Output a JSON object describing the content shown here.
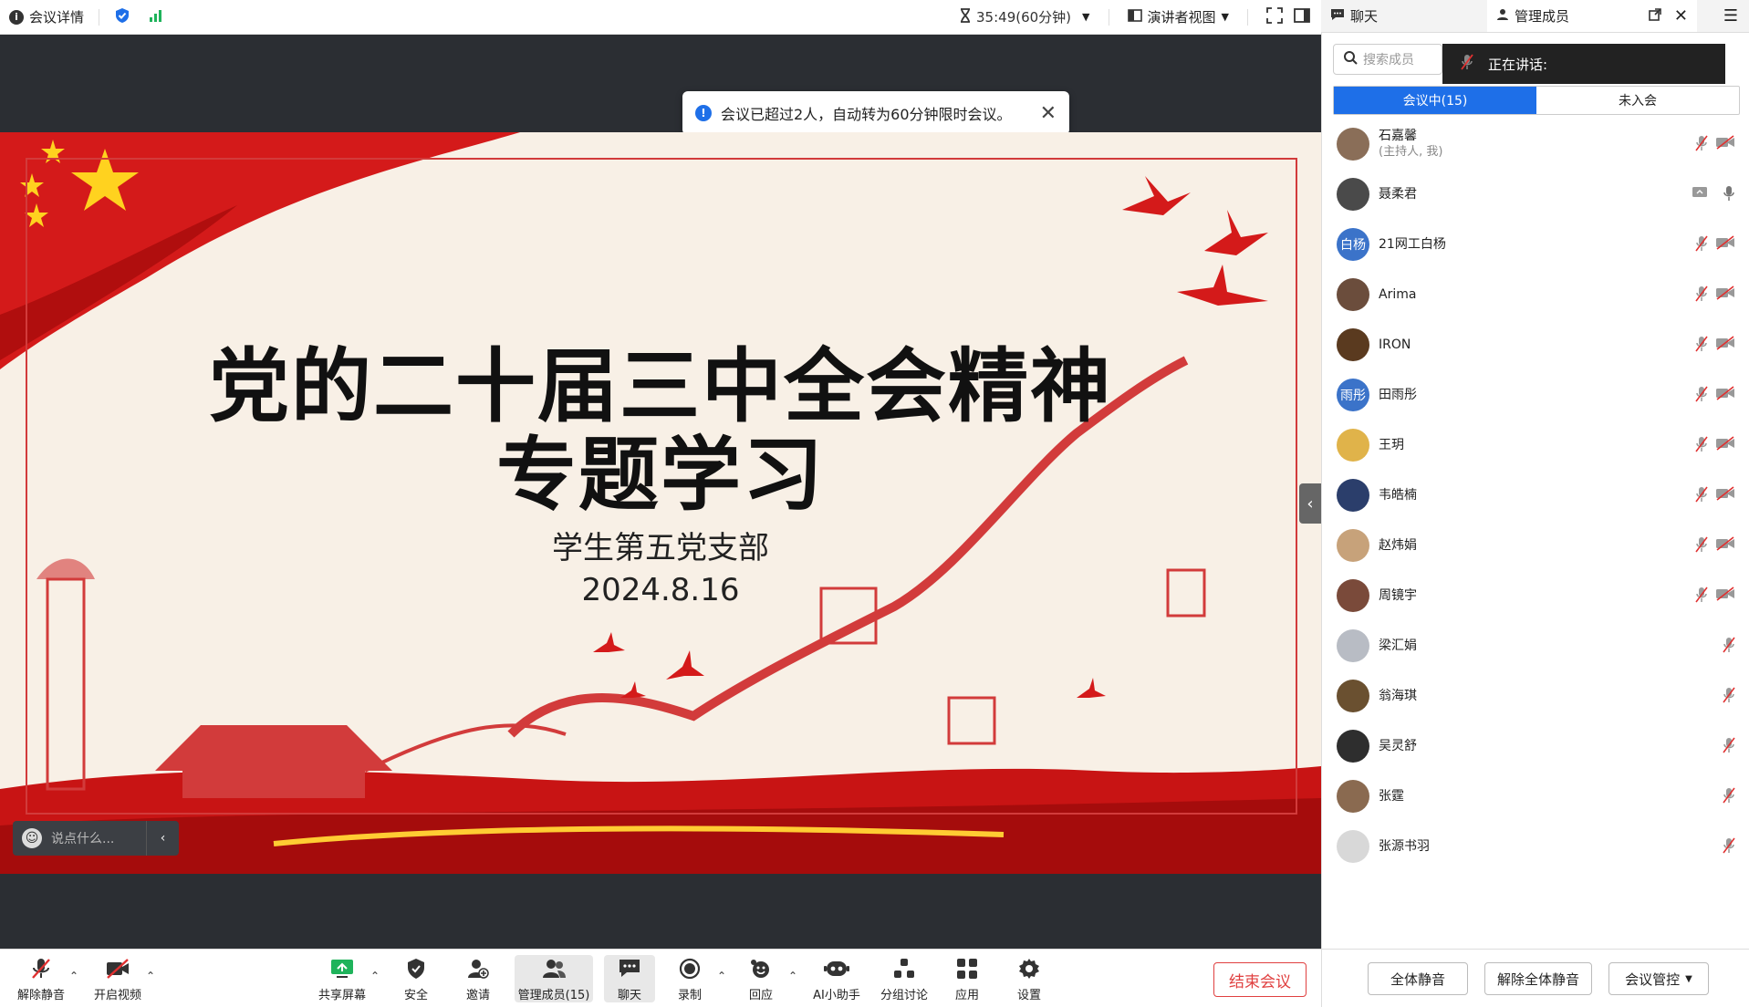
{
  "topbar": {
    "meeting_details": "会议详情",
    "timer": "35:49(60分钟)",
    "view_mode": "演讲者视图"
  },
  "notification": {
    "text": "会议已超过2人，自动转为60分钟限时会议。"
  },
  "slide": {
    "title_line1": "党的二十届三中全会精神",
    "title_line2": "专题学习",
    "subtitle": "学生第五党支部",
    "date": "2024.8.16"
  },
  "chat_input": {
    "placeholder": "说点什么..."
  },
  "toolbar": {
    "unmute": "解除静音",
    "start_video": "开启视频",
    "share_screen": "共享屏幕",
    "security": "安全",
    "invite": "邀请",
    "members": "管理成员(15)",
    "chat": "聊天",
    "record": "录制",
    "react": "回应",
    "ai_assistant": "AI小助手",
    "breakout": "分组讨论",
    "apps": "应用",
    "settings": "设置",
    "end_meeting": "结束会议"
  },
  "right_panel": {
    "tab_chat": "聊天",
    "tab_members": "管理成员",
    "search_placeholder": "搜索成员",
    "speaking_label": "正在讲话:",
    "seg_in_meeting": "会议中(15)",
    "seg_not_joined": "未入会",
    "members": [
      {
        "name": "石嘉馨",
        "sub": "(主持人, 我)",
        "avatar_text": "",
        "avatar_color": "#8a6e58",
        "video_off": true
      },
      {
        "name": "聂柔君",
        "sub": "",
        "avatar_text": "",
        "avatar_color": "#4a4a4a",
        "video_off": false,
        "screen": true
      },
      {
        "name": "21网工白杨",
        "sub": "",
        "avatar_text": "白杨",
        "avatar_color": "#3b73c9",
        "video_off": true
      },
      {
        "name": "Arima",
        "sub": "",
        "avatar_text": "",
        "avatar_color": "#6b4d3c",
        "video_off": true
      },
      {
        "name": "IRON",
        "sub": "",
        "avatar_text": "",
        "avatar_color": "#5a3a1f",
        "video_off": true
      },
      {
        "name": "田雨彤",
        "sub": "",
        "avatar_text": "雨彤",
        "avatar_color": "#3b73c9",
        "video_off": true
      },
      {
        "name": "王玥",
        "sub": "",
        "avatar_text": "",
        "avatar_color": "#e0b34a",
        "video_off": true
      },
      {
        "name": "韦皓楠",
        "sub": "",
        "avatar_text": "",
        "avatar_color": "#2b3e6b",
        "video_off": true
      },
      {
        "name": "赵炜娟",
        "sub": "",
        "avatar_text": "",
        "avatar_color": "#c7a27a",
        "video_off": true
      },
      {
        "name": "周镜宇",
        "sub": "",
        "avatar_text": "",
        "avatar_color": "#7a4a3a",
        "video_off": true
      },
      {
        "name": "梁汇娟",
        "sub": "",
        "avatar_text": "",
        "avatar_color": "#b8bcc4",
        "video_off": false
      },
      {
        "name": "翁海琪",
        "sub": "",
        "avatar_text": "",
        "avatar_color": "#6a5030",
        "video_off": false
      },
      {
        "name": "吴灵舒",
        "sub": "",
        "avatar_text": "",
        "avatar_color": "#2e2e2e",
        "video_off": false
      },
      {
        "name": "张霆",
        "sub": "",
        "avatar_text": "",
        "avatar_color": "#8a6a50",
        "video_off": false
      },
      {
        "name": "张源书羽",
        "sub": "",
        "avatar_text": "",
        "avatar_color": "#d8d8d8",
        "video_off": false
      }
    ],
    "footer": {
      "mute_all": "全体静音",
      "unmute_all": "解除全体静音",
      "meeting_control": "会议管控"
    }
  },
  "colors": {
    "accent_blue": "#1e6fe8",
    "end_red": "#e04040",
    "stage_bg": "#2b2e33"
  }
}
